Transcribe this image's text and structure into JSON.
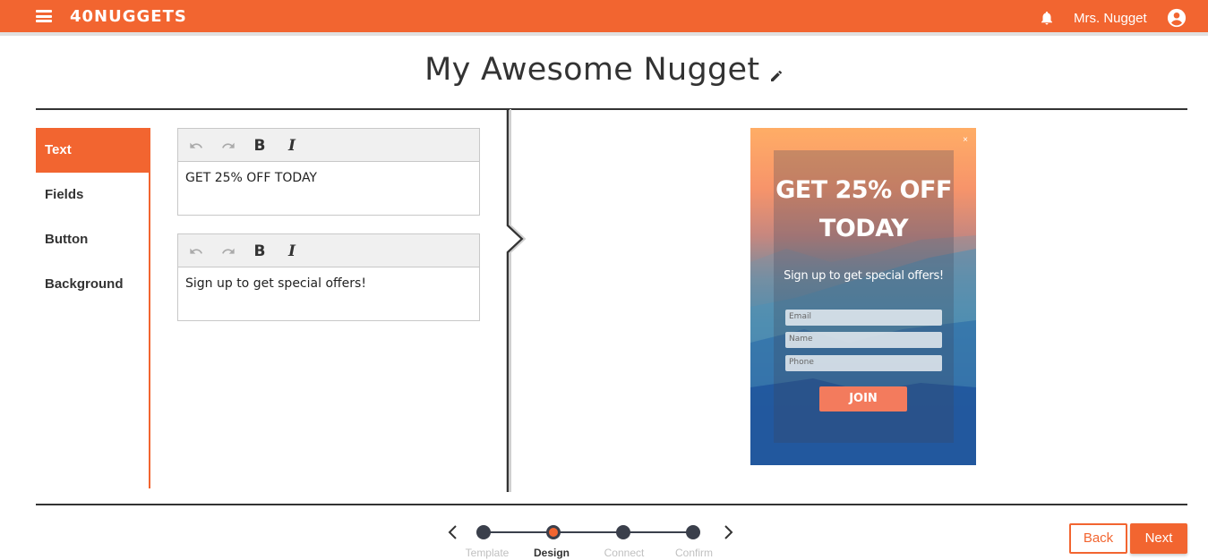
{
  "header": {
    "logo": "40NUGGETS",
    "user_name": "Mrs. Nugget"
  },
  "page": {
    "title": "My Awesome Nugget"
  },
  "tabs": [
    {
      "label": "Text",
      "active": true
    },
    {
      "label": "Fields",
      "active": false
    },
    {
      "label": "Button",
      "active": false
    },
    {
      "label": "Background",
      "active": false
    }
  ],
  "editors": [
    {
      "bold": "B",
      "italic": "I",
      "value": "GET 25% OFF TODAY"
    },
    {
      "bold": "B",
      "italic": "I",
      "value": "Sign up to get special offers!"
    }
  ],
  "preview": {
    "close": "×",
    "headline": "GET 25% OFF TODAY",
    "subtext": "Sign up to get special offers!",
    "fields": [
      "Email",
      "Name",
      "Phone"
    ],
    "button": "JOIN"
  },
  "stepper": {
    "steps": [
      {
        "label": "Template",
        "active": false
      },
      {
        "label": "Design",
        "active": true
      },
      {
        "label": "Connect",
        "active": false
      },
      {
        "label": "Confirm",
        "active": false
      }
    ]
  },
  "actions": {
    "back": "Back",
    "next": "Next"
  },
  "colors": {
    "brand": "#f26530",
    "dark": "#333333"
  }
}
